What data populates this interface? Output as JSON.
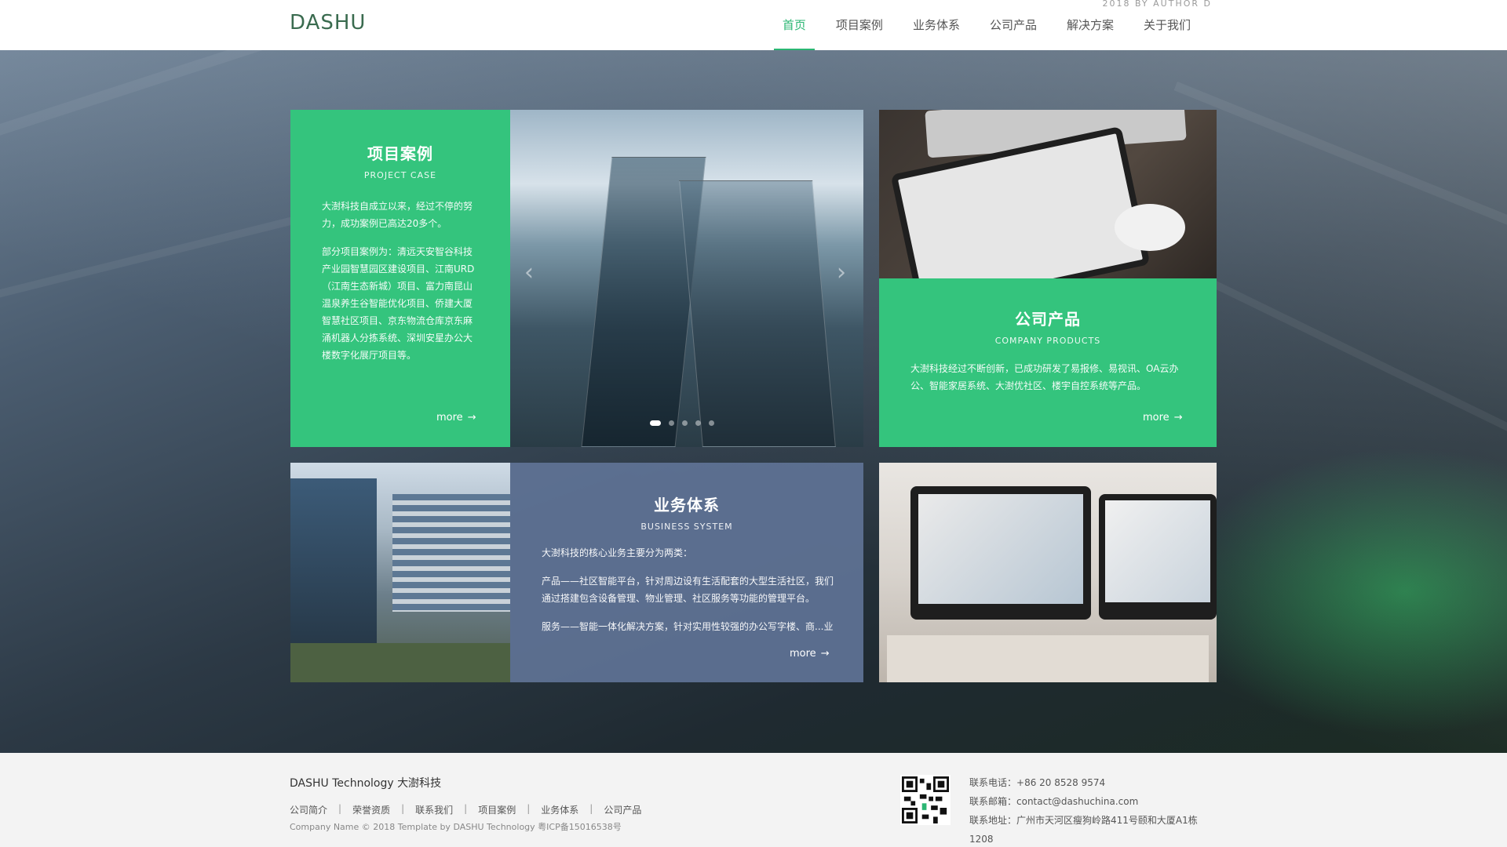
{
  "header": {
    "logo_text": "DASHU",
    "author": "2018 BY AUTHOR D",
    "nav": [
      {
        "label": "首页",
        "active": true
      },
      {
        "label": "项目案例"
      },
      {
        "label": "业务体系"
      },
      {
        "label": "公司产品"
      },
      {
        "label": "解决方案"
      },
      {
        "label": "关于我们"
      }
    ]
  },
  "project_case": {
    "title": "项目案例",
    "subtitle": "PROJECT CASE",
    "para1": "大澍科技自成立以来，经过不停的努力，成功案例已高达20多个。",
    "para2": "部分项目案例为：清远天安智谷科技产业园智慧园区建设项目、江南URD（江南生态新城）项目、富力南昆山温泉养生谷智能优化项目、侨建大厦智慧社区项目、京东物流仓库京东麻涌机器人分拣系统、深圳安星办公大楼数字化展厅项目等。",
    "more": "more"
  },
  "slider": {
    "prev_icon": "chevron-left-icon",
    "next_icon": "chevron-right-icon",
    "dots": 5,
    "active_dot": 0
  },
  "company_products": {
    "title": "公司产品",
    "subtitle": "COMPANY PRODUCTS",
    "para": "大澍科技经过不断创新，已成功研发了易报修、易视讯、OA云办公、智能家居系统、大澍优社区、楼宇自控系统等产品。",
    "more": "more"
  },
  "business_system": {
    "title": "业务体系",
    "subtitle": "BUSINESS SYSTEM",
    "para1": "大澍科技的核心业务主要分为两类：",
    "para2": "产品——社区智能平台，针对周边设有生活配套的大型生活社区，我们通过搭建包含设备管理、物业管理、社区服务等功能的管理平台。",
    "para3": "服务——智能一体化解决方案，针对实用性较强的办公写字楼、商...业",
    "more": "more"
  },
  "footer": {
    "brand": "DASHU Technology  大澍科技",
    "links": [
      "公司简介",
      "荣誉资质",
      "联系我们",
      "项目案例",
      "业务体系",
      "公司产品"
    ],
    "copyright": "Company Name © 2018 Template by  DASHU Technology 粤ICP备15016538号",
    "phone_label": "联系电话：",
    "phone": "+86 20 8528 9574",
    "email_label": "联系邮箱：",
    "email": "contact@dashuchina.com",
    "address_label": "联系地址：",
    "address": "广州市天河区瘦狗岭路411号颐和大厦A1栋1208"
  },
  "colors": {
    "accent": "#2bb673",
    "green_tile": "#34c47d",
    "slate_tile": "#60739a"
  }
}
